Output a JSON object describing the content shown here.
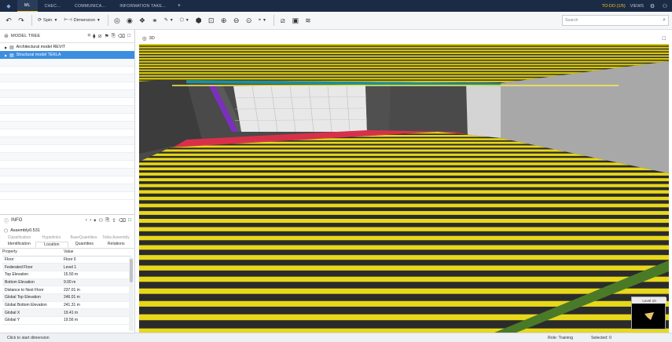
{
  "tabbar": {
    "tabs": [
      {
        "label": "ML"
      },
      {
        "label": "CHEC..."
      },
      {
        "label": "COMMUNICA..."
      },
      {
        "label": "INFORMATION TAKE..."
      }
    ],
    "todo": "TO-DO (1/5)",
    "views": "VIEWS"
  },
  "toolbar": {
    "spin_label": "Spin",
    "dimension_label": "Dimension",
    "search_placeholder": "Search"
  },
  "model_tree": {
    "title": "MODEL TREE",
    "items": [
      {
        "label": "Architectural model REVIT"
      },
      {
        "label": "Structural model TEKLA"
      }
    ]
  },
  "info": {
    "title": "INFO",
    "object": "Assembly0.531",
    "tabs_top": [
      "Classification",
      "Hyperlinks",
      "BaseQuantities",
      "Tekla Assembly"
    ],
    "tabs_bottom": [
      "Identification",
      "Location",
      "Quantities",
      "Relations"
    ],
    "active_tab": "Location",
    "columns": [
      "Property",
      "Value"
    ],
    "rows": [
      {
        "k": "Floor",
        "v": "Floor 0"
      },
      {
        "k": "Federated Floor",
        "v": "Level 1"
      },
      {
        "k": "Top Elevation",
        "v": "15.50 m"
      },
      {
        "k": "Bottom Elevation",
        "v": "9.00 m"
      },
      {
        "k": "Distance to Next Floor",
        "v": "237.01 m"
      },
      {
        "k": "Global Top Elevation",
        "v": "246.01 m"
      },
      {
        "k": "Global Bottom Elevation",
        "v": "241.31 m"
      },
      {
        "k": "Global X",
        "v": "19.41 m"
      },
      {
        "k": "Global Y",
        "v": "19.56 m"
      }
    ]
  },
  "viewport": {
    "title": "3D",
    "minimap_label": "Level 10"
  },
  "status": {
    "hint": "Click to start dimension",
    "role": "Role: Training",
    "selected": "Selected: 0"
  },
  "colors": {
    "tabbar_bg": "#1c2b45",
    "accent_yellow": "#f3c623",
    "selection_blue": "#3c8ee0"
  }
}
